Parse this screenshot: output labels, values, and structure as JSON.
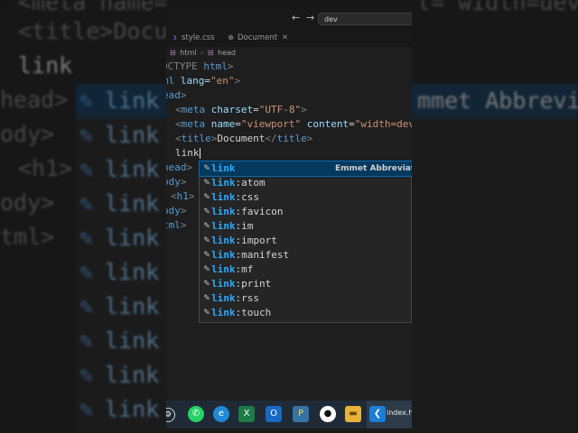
{
  "window": {
    "search_text": "dev",
    "back_glyph": "←",
    "forward_glyph": "→"
  },
  "tabs": [
    {
      "label": "style.css",
      "icon": "css-file-icon"
    },
    {
      "label": "Document",
      "icon": "preview-icon"
    }
  ],
  "breadcrumb": {
    "items": [
      "html",
      "head"
    ]
  },
  "code": {
    "line1": {
      "p1": "OCTYPE ",
      "p2": "html",
      "p3": ">"
    },
    "line2": {
      "p1": "ml ",
      "p2": "lang",
      "p3": "=",
      "p4": "\"en\"",
      "p5": ">"
    },
    "line3": {
      "p1": "ead",
      "p2": ">"
    },
    "line4": {
      "p1": "<",
      "p2": "meta ",
      "p3": "charset",
      "p4": "=",
      "p5": "\"UTF-8\"",
      "p6": ">"
    },
    "line5": {
      "p1": "<",
      "p2": "meta ",
      "p3": "name",
      "p4": "=",
      "p5": "\"viewport\"",
      "p6": " content",
      "p7": "=",
      "p8": "\"width=dev"
    },
    "line6": {
      "p1": "<",
      "p2": "title",
      "p3": ">",
      "p4": "Document",
      "p5": "</",
      "p6": "title",
      "p7": ">"
    },
    "line7": {
      "typed": "link"
    },
    "line8": {
      "p1": "head",
      "p2": ">"
    },
    "line9": {
      "p1": "ody",
      "p2": ">"
    },
    "line10": {
      "p1": "<",
      "p2": "h1",
      "p3": ">"
    },
    "line11": {
      "p1": "ody",
      "p2": ">"
    },
    "line12": {
      "p1": "tml",
      "p2": ">"
    }
  },
  "suggestions": {
    "detail": "Emmet Abbreviat",
    "items": [
      {
        "prefix": "link",
        "suffix": ""
      },
      {
        "prefix": "link",
        "suffix": ":atom"
      },
      {
        "prefix": "link",
        "suffix": ":css"
      },
      {
        "prefix": "link",
        "suffix": ":favicon"
      },
      {
        "prefix": "link",
        "suffix": ":im"
      },
      {
        "prefix": "link",
        "suffix": ":import"
      },
      {
        "prefix": "link",
        "suffix": ":manifest"
      },
      {
        "prefix": "link",
        "suffix": ":mf"
      },
      {
        "prefix": "link",
        "suffix": ":print"
      },
      {
        "prefix": "link",
        "suffix": ":rss"
      },
      {
        "prefix": "link",
        "suffix": ":touch"
      }
    ]
  },
  "taskbar": {
    "active_label": "index.ht",
    "icons": [
      "settings-icon",
      "whatsapp-icon",
      "edge-icon",
      "excel-icon",
      "outlook-icon",
      "python-icon",
      "github-icon",
      "file-explorer-icon",
      "vscode-icon"
    ]
  },
  "background": {
    "line1": "<meta name=",
    "line1b": "t= width=dev",
    "line2": "<title>Docu",
    "line3": "link",
    "line4": "head>",
    "line5": "ody>",
    "line6": "<h1>",
    "line7": "ody>",
    "line8": "tml>",
    "item_text": "link",
    "detail": "mmet Abbreviat"
  },
  "colors": {
    "editor_bg": "#1e1e1e",
    "suggest_bg": "#252526",
    "selection": "#04395e",
    "match_highlight": "#2aaaff",
    "keyword": "#569cd6",
    "attribute": "#9cdcfe",
    "string": "#ce9178"
  }
}
